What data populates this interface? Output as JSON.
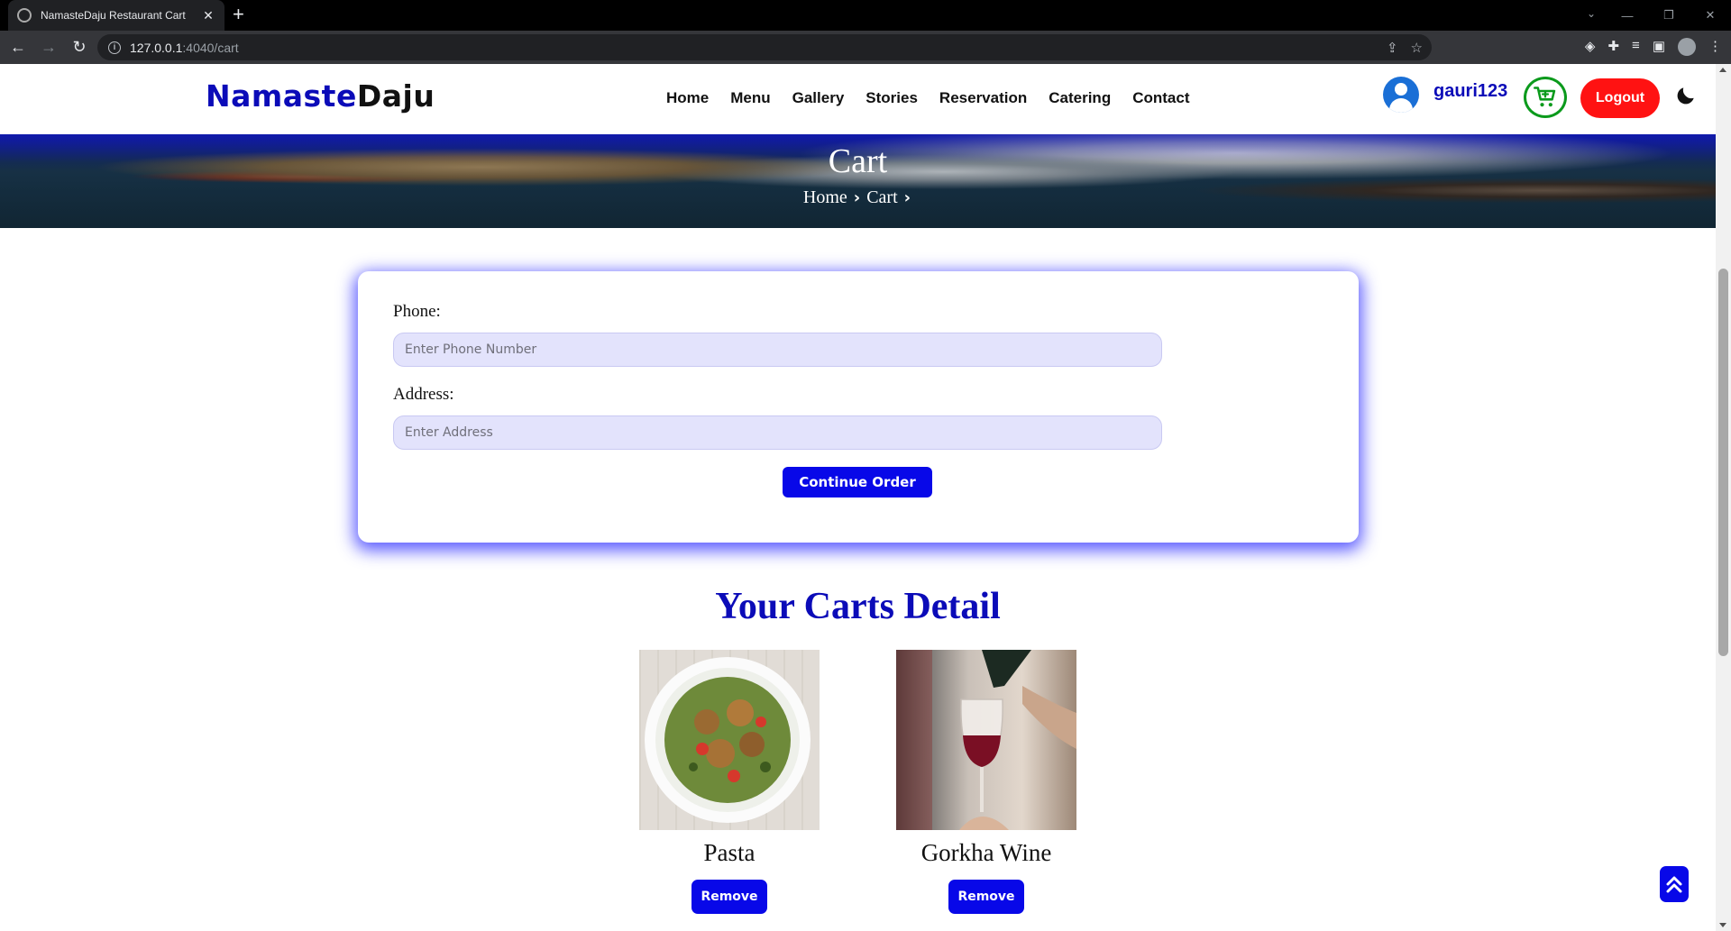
{
  "browser": {
    "tab_title": "NamasteDaju Restaurant Cart",
    "url_host": "127.0.0.1",
    "url_path": ":4040/cart"
  },
  "site": {
    "logo_part1": "Namaste",
    "logo_part2": "Daju",
    "nav": [
      "Home",
      "Menu",
      "Gallery",
      "Stories",
      "Reservation",
      "Catering",
      "Contact"
    ],
    "username": "gauri123",
    "logout_label": "Logout",
    "accent_color": "#0808e8",
    "logout_color": "#ff1212",
    "cart_color": "#0b9a1c"
  },
  "hero": {
    "title": "Cart",
    "breadcrumb": [
      "Home",
      "Cart"
    ]
  },
  "order_form": {
    "phone_label": "Phone:",
    "phone_placeholder": "Enter Phone Number",
    "phone_value": "",
    "address_label": "Address:",
    "address_placeholder": "Enter Address",
    "address_value": "",
    "continue_label": "Continue Order"
  },
  "cart": {
    "title": "Your Carts Detail",
    "items": [
      {
        "name": "Pasta",
        "remove_label": "Remove"
      },
      {
        "name": "Gorkha Wine",
        "remove_label": "Remove"
      }
    ]
  }
}
